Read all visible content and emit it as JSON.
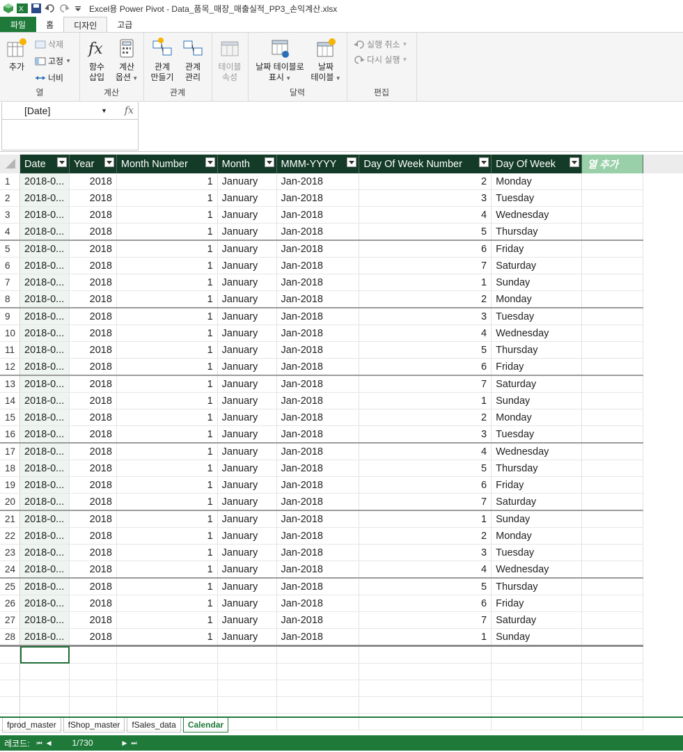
{
  "window": {
    "title": "Excel용 Power Pivot - Data_품목_매장_매출실적_PP3_손익계산.xlsx"
  },
  "tabs": [
    {
      "label": "파일"
    },
    {
      "label": "홈"
    },
    {
      "label": "디자인"
    },
    {
      "label": "고급"
    }
  ],
  "ribbon": {
    "columns_group": {
      "label": "열",
      "add": "추가",
      "delete": "삭제",
      "freeze": "고정",
      "width": "너비"
    },
    "calc_group": {
      "label": "계산",
      "insert_fn_1": "함수",
      "insert_fn_2": "삽입",
      "calc_opt_1": "계산",
      "calc_opt_2": "옵션"
    },
    "rel_group": {
      "label": "관계",
      "create_1": "관계",
      "create_2": "만들기",
      "manage_1": "관계",
      "manage_2": "관리"
    },
    "table_props": {
      "line1": "테이블",
      "line2": "속성"
    },
    "calendar_group": {
      "label": "달력",
      "mark_1": "날짜 테이블로",
      "mark_2": "표시",
      "date_1": "날짜",
      "date_2": "테이블"
    },
    "edit_group": {
      "label": "편집",
      "undo": "실행 취소",
      "redo": "다시 실행"
    }
  },
  "formula_bar": {
    "name_box": "[Date]",
    "fx": "fx"
  },
  "table": {
    "columns": [
      "Date",
      "Year",
      "Month Number",
      "Month",
      "MMM-YYYY",
      "Day Of Week Number",
      "Day Of Week"
    ],
    "add_column": "열 추가",
    "rows": [
      [
        "1",
        "2018-0...",
        "2018",
        "1",
        "January",
        "Jan-2018",
        "2",
        "Monday"
      ],
      [
        "2",
        "2018-0...",
        "2018",
        "1",
        "January",
        "Jan-2018",
        "3",
        "Tuesday"
      ],
      [
        "3",
        "2018-0...",
        "2018",
        "1",
        "January",
        "Jan-2018",
        "4",
        "Wednesday"
      ],
      [
        "4",
        "2018-0...",
        "2018",
        "1",
        "January",
        "Jan-2018",
        "5",
        "Thursday"
      ],
      [
        "5",
        "2018-0...",
        "2018",
        "1",
        "January",
        "Jan-2018",
        "6",
        "Friday"
      ],
      [
        "6",
        "2018-0...",
        "2018",
        "1",
        "January",
        "Jan-2018",
        "7",
        "Saturday"
      ],
      [
        "7",
        "2018-0...",
        "2018",
        "1",
        "January",
        "Jan-2018",
        "1",
        "Sunday"
      ],
      [
        "8",
        "2018-0...",
        "2018",
        "1",
        "January",
        "Jan-2018",
        "2",
        "Monday"
      ],
      [
        "9",
        "2018-0...",
        "2018",
        "1",
        "January",
        "Jan-2018",
        "3",
        "Tuesday"
      ],
      [
        "10",
        "2018-0...",
        "2018",
        "1",
        "January",
        "Jan-2018",
        "4",
        "Wednesday"
      ],
      [
        "11",
        "2018-0...",
        "2018",
        "1",
        "January",
        "Jan-2018",
        "5",
        "Thursday"
      ],
      [
        "12",
        "2018-0...",
        "2018",
        "1",
        "January",
        "Jan-2018",
        "6",
        "Friday"
      ],
      [
        "13",
        "2018-0...",
        "2018",
        "1",
        "January",
        "Jan-2018",
        "7",
        "Saturday"
      ],
      [
        "14",
        "2018-0...",
        "2018",
        "1",
        "January",
        "Jan-2018",
        "1",
        "Sunday"
      ],
      [
        "15",
        "2018-0...",
        "2018",
        "1",
        "January",
        "Jan-2018",
        "2",
        "Monday"
      ],
      [
        "16",
        "2018-0...",
        "2018",
        "1",
        "January",
        "Jan-2018",
        "3",
        "Tuesday"
      ],
      [
        "17",
        "2018-0...",
        "2018",
        "1",
        "January",
        "Jan-2018",
        "4",
        "Wednesday"
      ],
      [
        "18",
        "2018-0...",
        "2018",
        "1",
        "January",
        "Jan-2018",
        "5",
        "Thursday"
      ],
      [
        "19",
        "2018-0...",
        "2018",
        "1",
        "January",
        "Jan-2018",
        "6",
        "Friday"
      ],
      [
        "20",
        "2018-0...",
        "2018",
        "1",
        "January",
        "Jan-2018",
        "7",
        "Saturday"
      ],
      [
        "21",
        "2018-0...",
        "2018",
        "1",
        "January",
        "Jan-2018",
        "1",
        "Sunday"
      ],
      [
        "22",
        "2018-0...",
        "2018",
        "1",
        "January",
        "Jan-2018",
        "2",
        "Monday"
      ],
      [
        "23",
        "2018-0...",
        "2018",
        "1",
        "January",
        "Jan-2018",
        "3",
        "Tuesday"
      ],
      [
        "24",
        "2018-0...",
        "2018",
        "1",
        "January",
        "Jan-2018",
        "4",
        "Wednesday"
      ],
      [
        "25",
        "2018-0...",
        "2018",
        "1",
        "January",
        "Jan-2018",
        "5",
        "Thursday"
      ],
      [
        "26",
        "2018-0...",
        "2018",
        "1",
        "January",
        "Jan-2018",
        "6",
        "Friday"
      ],
      [
        "27",
        "2018-0...",
        "2018",
        "1",
        "January",
        "Jan-2018",
        "7",
        "Saturday"
      ],
      [
        "28",
        "2018-0...",
        "2018",
        "1",
        "January",
        "Jan-2018",
        "1",
        "Sunday"
      ]
    ]
  },
  "sheet_tabs": [
    "fprod_master",
    "fShop_master",
    "fSales_data",
    "Calendar"
  ],
  "active_sheet": "Calendar",
  "status": {
    "label": "레코드:",
    "position": "1/730"
  },
  "colors": {
    "accent": "#1f7a3a",
    "header_bg": "#143b28",
    "add_column_bg": "#9ad0a9"
  }
}
